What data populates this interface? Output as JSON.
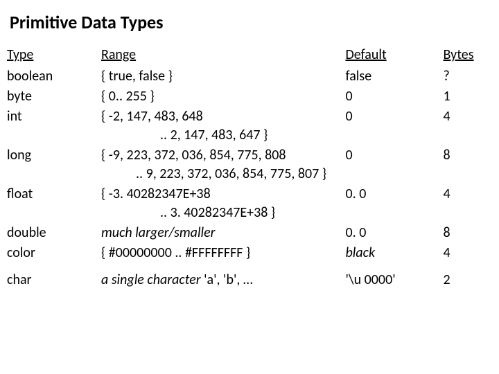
{
  "title": "Primitive Data Types",
  "headers": {
    "type": "Type",
    "range": "Range",
    "default": "Default",
    "bytes": "Bytes"
  },
  "rows": {
    "boolean": {
      "type": "boolean",
      "range": "{ true, false }",
      "default": "false",
      "bytes": "?"
    },
    "byte": {
      "type": "byte",
      "range": "{ 0.. 255 }",
      "default": "0",
      "bytes": "1"
    },
    "int": {
      "type": "int",
      "range_l1": "{ -2, 147, 483, 648",
      "range_l2": ".. 2, 147, 483, 647 }",
      "default": "0",
      "bytes": "4"
    },
    "long": {
      "type": "long",
      "range_l1": "{ -9, 223, 372, 036, 854, 775, 808",
      "range_l2": ".. 9, 223, 372, 036, 854, 775, 807 }",
      "default": "0",
      "bytes": "8"
    },
    "float": {
      "type": "float",
      "range_l1": "{ -3. 40282347E+38",
      "range_l2": ".. 3. 40282347E+38 }",
      "default": "0. 0",
      "bytes": "4"
    },
    "double": {
      "type": "double",
      "range": "much larger/smaller",
      "default": "0. 0",
      "bytes": "8"
    },
    "color": {
      "type": "color",
      "range": "{ #00000000 .. #FFFFFFFF }",
      "default": "black",
      "bytes": "4"
    },
    "char": {
      "type": "char",
      "range_prefix": "a single character ",
      "range_suffix": "'a', 'b', …",
      "default": "'\\u 0000'",
      "bytes": "2"
    }
  }
}
